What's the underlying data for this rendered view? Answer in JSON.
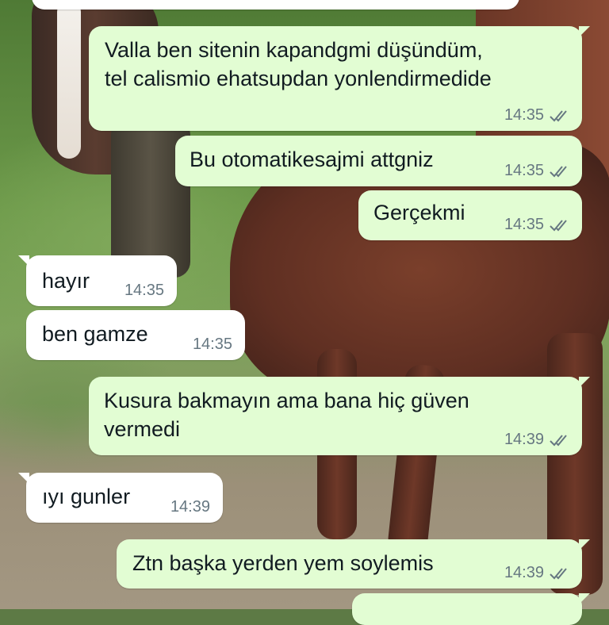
{
  "messages": [
    {
      "direction": "out",
      "lines": [
        "Valla ben sitenin kapandgmi düşündüm,",
        "tel calismio ehatsupdan yonlendirmedide"
      ],
      "time": "14:35",
      "status_icon": "double-check-icon"
    },
    {
      "direction": "out",
      "lines": [
        "Bu otomatikesajmi attgniz"
      ],
      "time": "14:35",
      "status_icon": "double-check-icon"
    },
    {
      "direction": "out",
      "lines": [
        "Gerçekmi"
      ],
      "time": "14:35",
      "status_icon": "double-check-icon"
    },
    {
      "direction": "in",
      "lines": [
        "hayır"
      ],
      "time": "14:35"
    },
    {
      "direction": "in",
      "lines": [
        "ben gamze"
      ],
      "time": "14:35"
    },
    {
      "direction": "out",
      "lines": [
        "Kusura bakmayın ama bana hiç güven",
        "vermedi"
      ],
      "time": "14:39",
      "status_icon": "double-check-icon"
    },
    {
      "direction": "in",
      "lines": [
        "ıyı gunler"
      ],
      "time": "14:39"
    },
    {
      "direction": "out",
      "lines": [
        "Ztn başka yerden yem soylemis"
      ],
      "time": "14:39",
      "status_icon": "double-check-icon"
    }
  ],
  "colors": {
    "outgoing_bubble": "#e2fdd3",
    "incoming_bubble": "#ffffff",
    "text": "#111b21",
    "meta": "#667781"
  }
}
